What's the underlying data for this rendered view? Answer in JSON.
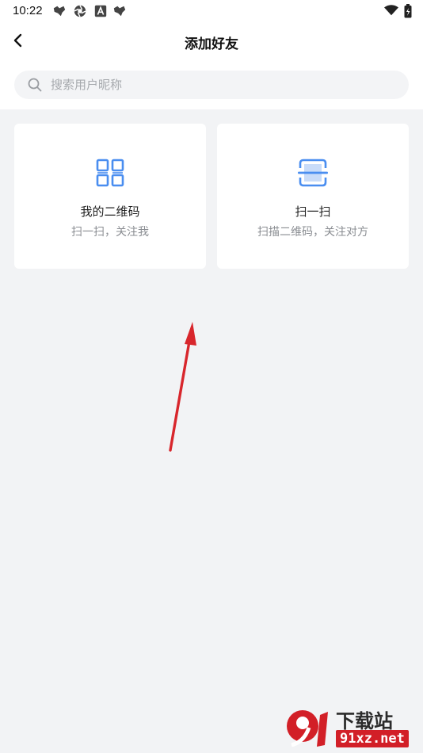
{
  "status_bar": {
    "time": "10:22",
    "left_icons": [
      "wolf-icon",
      "aperture-icon",
      "app-a-icon",
      "wolf-icon"
    ],
    "right_icons": [
      "wifi-icon",
      "battery-icon"
    ]
  },
  "nav": {
    "title": "添加好友",
    "back_icon": "chevron-left-icon"
  },
  "search": {
    "placeholder": "搜索用户昵称",
    "icon": "search-icon"
  },
  "cards": [
    {
      "title": "我的二维码",
      "subtitle": "扫一扫，关注我",
      "icon": "qr-code-icon"
    },
    {
      "title": "扫一扫",
      "subtitle": "扫描二维码，关注对方",
      "icon": "scan-icon"
    }
  ],
  "colors": {
    "accent": "#4a8ef0",
    "background": "#f2f3f5",
    "arrow": "#d8262c",
    "watermark": "#d21f27"
  },
  "watermark": {
    "line1": "下载站",
    "line2": "91xz.net"
  }
}
